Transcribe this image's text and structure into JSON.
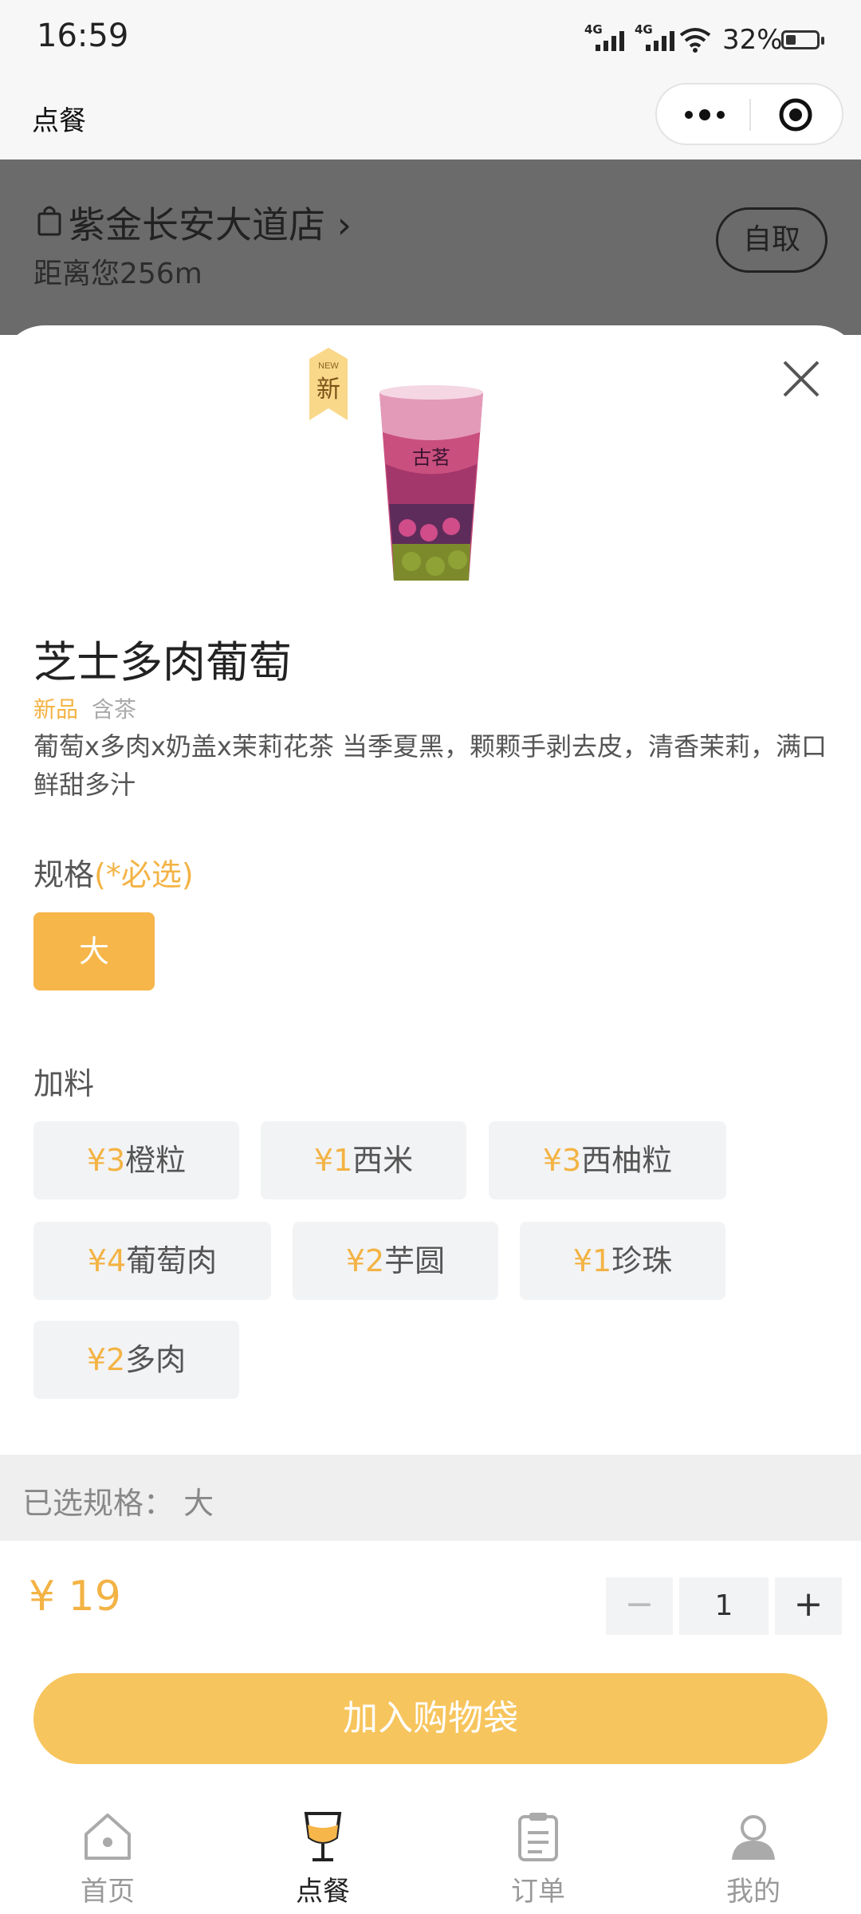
{
  "status_bar": {
    "time": "16:59",
    "signal1": "4G",
    "signal2": "4G",
    "battery": "32%"
  },
  "app_header": {
    "title": "点餐"
  },
  "store": {
    "name": "紫金长安大道店",
    "distance": "距离您256m",
    "pickup_label": "自取"
  },
  "product": {
    "badge_top": "NEW",
    "badge_main": "新",
    "cup_brand": "古茗",
    "name": "芝士多肉葡萄",
    "tags": [
      "新品",
      "含茶"
    ],
    "description": "葡萄x多肉x奶盖x茉莉花茶 当季夏黑，颗颗手剥去皮，清香茉莉，满口鲜甜多汁"
  },
  "spec": {
    "title": "规格",
    "required": "(*必选)",
    "options": [
      "大"
    ],
    "selected": "大"
  },
  "addons": {
    "title": "加料",
    "items": [
      {
        "price": "¥3",
        "name": "橙粒"
      },
      {
        "price": "¥1",
        "name": "西米"
      },
      {
        "price": "¥3",
        "name": "西柚粒"
      },
      {
        "price": "¥4",
        "name": "葡萄肉"
      },
      {
        "price": "¥2",
        "name": "芋圆"
      },
      {
        "price": "¥1",
        "name": "珍珠"
      },
      {
        "price": "¥2",
        "name": "多肉"
      }
    ]
  },
  "selected_summary": "已选规格： 大",
  "price": "¥ 19",
  "quantity": {
    "minus": "−",
    "value": "1",
    "plus": "+"
  },
  "add_button": "加入购物袋",
  "tabs": [
    {
      "label": "首页",
      "icon": "home-icon"
    },
    {
      "label": "点餐",
      "icon": "drink-icon",
      "active": true
    },
    {
      "label": "订单",
      "icon": "order-icon"
    },
    {
      "label": "我的",
      "icon": "user-icon"
    }
  ],
  "colors": {
    "accent": "#f6b64a",
    "button": "#f7c55d",
    "overlay": "#6b6b6b"
  }
}
